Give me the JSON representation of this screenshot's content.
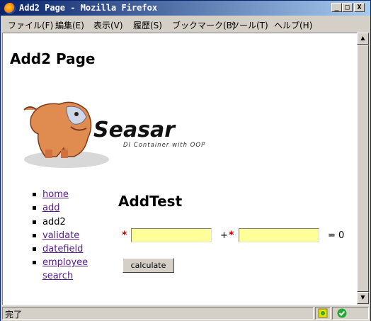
{
  "window": {
    "title": "Add2 Page - Mozilla Firefox",
    "controls": {
      "minimize": "_",
      "maximize": "□",
      "close": "X"
    }
  },
  "menu": [
    "ファイル(F)",
    "編集(E)",
    "表示(V)",
    "履歴(S)",
    "ブックマーク(B)",
    "ツール(T)",
    "ヘルプ(H)"
  ],
  "page": {
    "title": "Add2 Page",
    "logo": {
      "brand": "Seasar",
      "tagline": "DI Container with OOP"
    },
    "nav": [
      {
        "label": "home",
        "link": true
      },
      {
        "label": "add",
        "link": true
      },
      {
        "label": "add2",
        "link": false
      },
      {
        "label": "validate",
        "link": true
      },
      {
        "label": "datefield",
        "link": true
      },
      {
        "label": "employee search",
        "link": true
      }
    ],
    "section_title": "AddTest",
    "form": {
      "required_mark": "*",
      "arg1_value": "",
      "arg2_value": "",
      "plus": "+",
      "result": "= 0",
      "input_color": "#ffff99",
      "required_color": "#cc0000",
      "submit_label": "calculate"
    }
  },
  "status": {
    "text": "完了"
  },
  "colors": {
    "link": "#551a8b",
    "titlebar": "#0a246a"
  }
}
